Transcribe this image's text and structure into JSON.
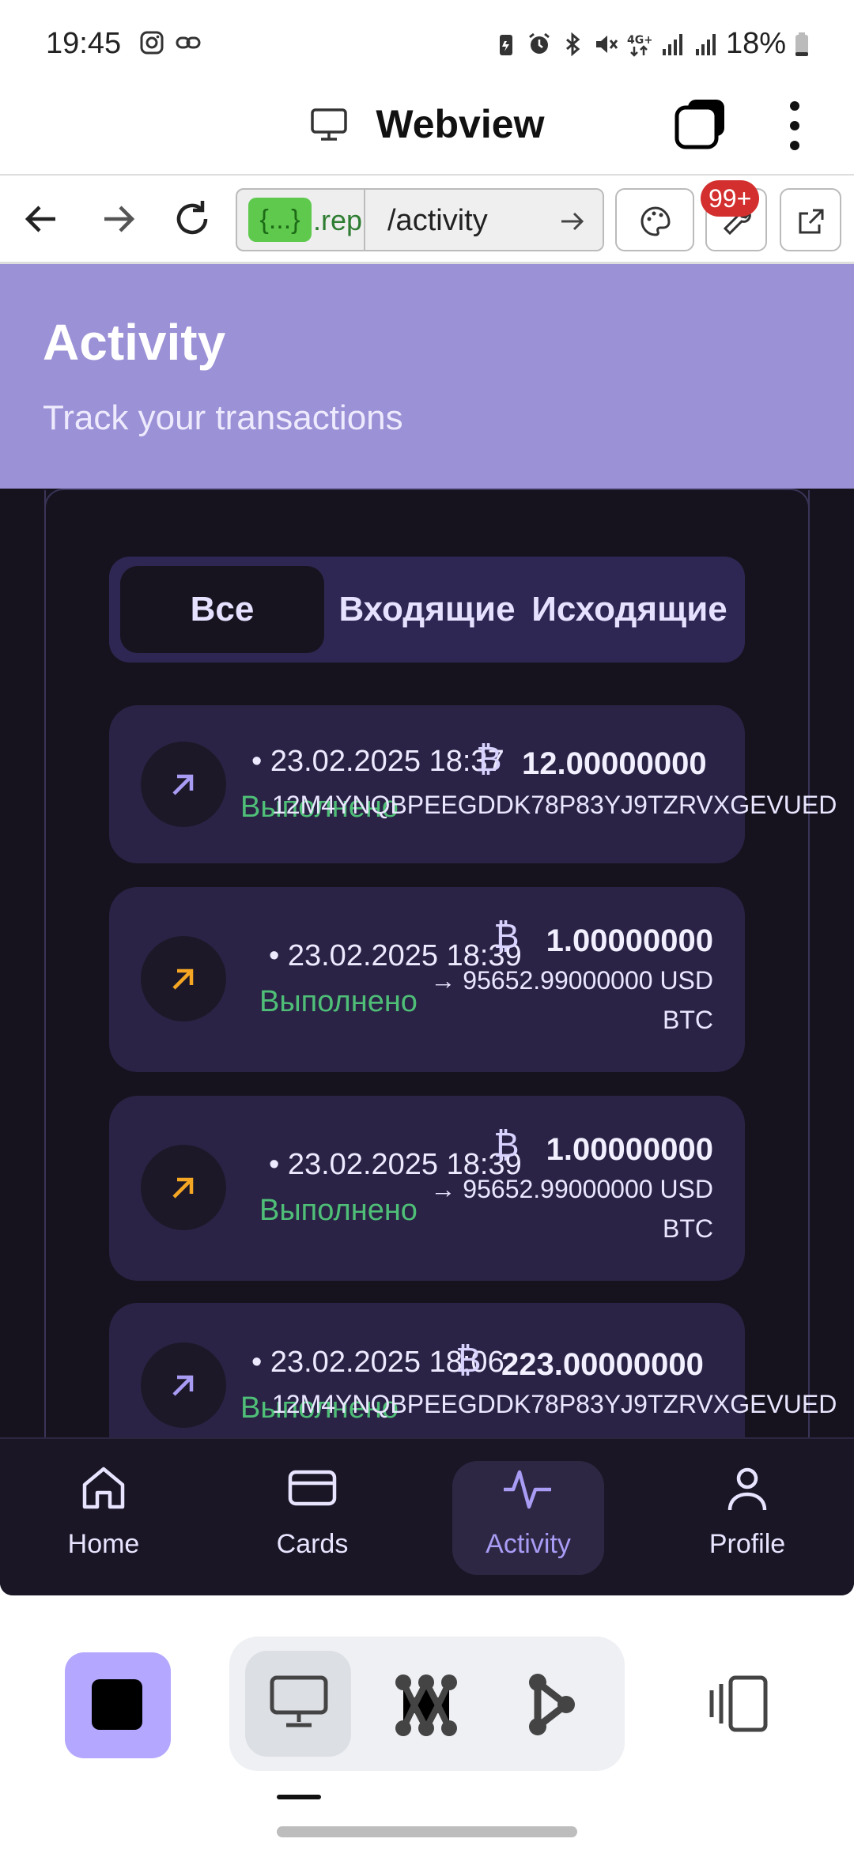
{
  "status_bar": {
    "time": "19:45",
    "battery": "18%",
    "icons": [
      "instagram-icon",
      "link-icon",
      "battery-saver-icon",
      "alarm-icon",
      "bluetooth-icon",
      "mute-icon",
      "4g-icon",
      "signal-icon",
      "battery-icon"
    ]
  },
  "webview": {
    "title": "Webview",
    "url_chip": "{...}",
    "url_host": ".rep",
    "url_path": "/activity",
    "notifications_badge": "99+"
  },
  "app": {
    "title": "Activity",
    "subtitle": "Track your transactions",
    "filters": [
      {
        "label": "Все",
        "active": true
      },
      {
        "label": "Входящие",
        "active": false
      },
      {
        "label": "Исходящие",
        "active": false
      }
    ],
    "transactions": [
      {
        "direction": "outgoing",
        "date": "• 23.02.2025 18:37",
        "status": "Выполнено",
        "currency_symbol": "₿",
        "amount": "12.00000000",
        "line2": "12M4YNQBPEEGDDK78P83YJ9TZRVXGEVUED",
        "line3": ""
      },
      {
        "direction": "exchange",
        "date": "• 23.02.2025 18:39",
        "status": "Выполнено",
        "currency_symbol": "₿",
        "amount": "1.00000000",
        "line2": "→ 95652.99000000 USD",
        "line3": "BTC"
      },
      {
        "direction": "exchange",
        "date": "• 23.02.2025 18:39",
        "status": "Выполнено",
        "currency_symbol": "₿",
        "amount": "1.00000000",
        "line2": "→ 95652.99000000 USD",
        "line3": "BTC"
      },
      {
        "direction": "outgoing",
        "date": "• 23.02.2025 18:06",
        "status": "Выполнено",
        "currency_symbol": "₿",
        "amount": "223.00000000",
        "line2": "12M4YNQBPEEGDDK78P83YJ9TZRVXGEVUED",
        "line3": ""
      }
    ],
    "bottom_nav": [
      {
        "label": "Home",
        "icon": "home-icon",
        "active": false
      },
      {
        "label": "Cards",
        "icon": "card-icon",
        "active": false
      },
      {
        "label": "Activity",
        "icon": "activity-icon",
        "active": true
      },
      {
        "label": "Profile",
        "icon": "user-icon",
        "active": false
      }
    ]
  },
  "colors": {
    "header": "#9b91d6",
    "app_bg": "#16131f",
    "card_bg": "#2a2345",
    "status_ok": "#4fbf78",
    "arrow_purple": "#a89cf5",
    "arrow_orange": "#f5a623",
    "active_tab_label": "#a89cf5"
  }
}
